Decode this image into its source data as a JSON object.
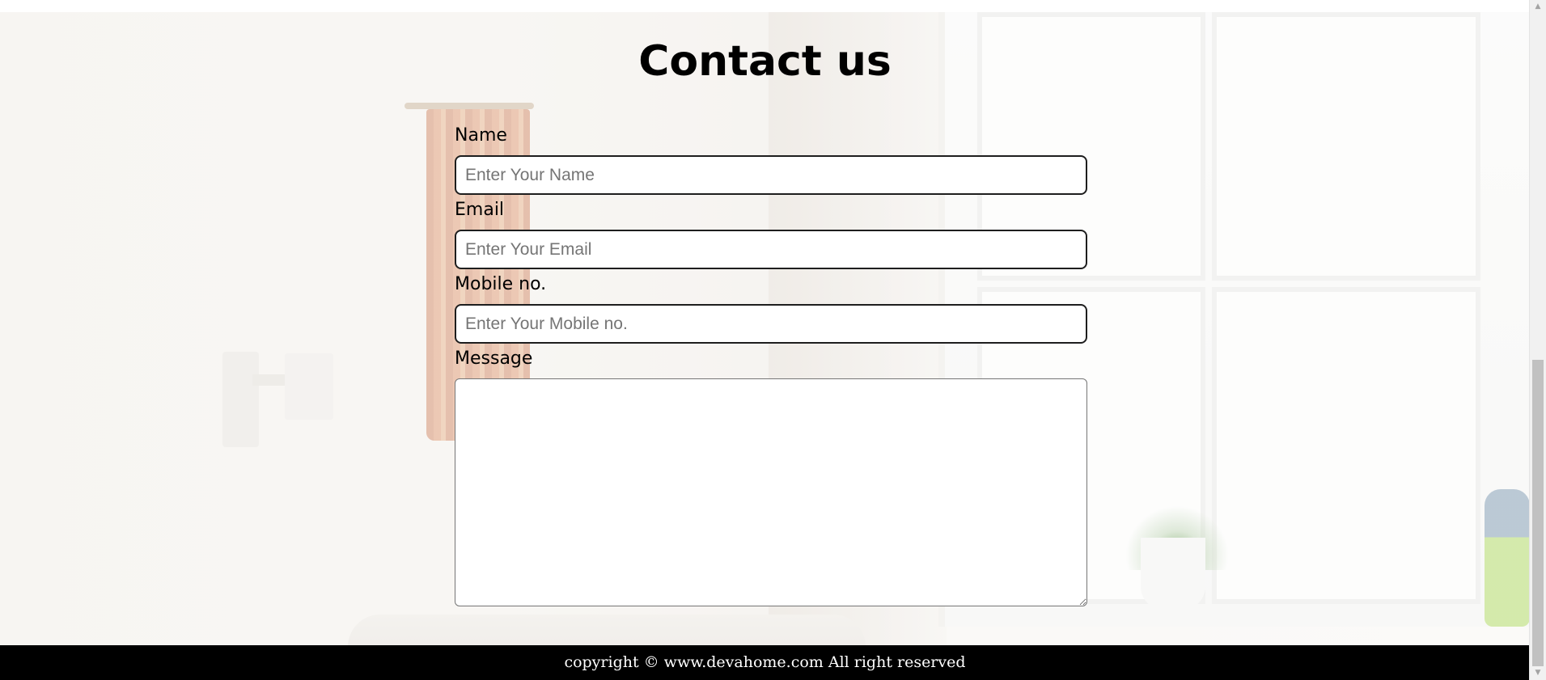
{
  "page": {
    "title": "Contact us"
  },
  "form": {
    "fields": [
      {
        "label": "Name",
        "placeholder": "Enter Your Name",
        "value": ""
      },
      {
        "label": "Email",
        "placeholder": "Enter Your Email",
        "value": ""
      },
      {
        "label": "Mobile no.",
        "placeholder": "Enter Your Mobile no.",
        "value": ""
      }
    ],
    "message": {
      "label": "Message",
      "value": ""
    }
  },
  "footer": {
    "text": "copyright © www.devahome.com All right reserved"
  },
  "colors": {
    "footer_bg": "#000000",
    "footer_text": "#ffffff",
    "input_border": "#1e1e1e"
  }
}
